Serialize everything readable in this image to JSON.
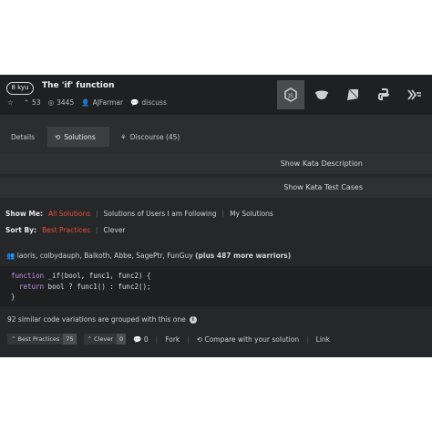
{
  "kata": {
    "rank": "8 kyu",
    "title": "The 'if' function",
    "votes": "53",
    "completed": "3445",
    "author": "AJFarmar",
    "discuss": "discuss"
  },
  "languages": [
    "javascript-icon",
    "coffeescript-icon",
    "ruby-icon",
    "python-icon",
    "haskell-icon",
    "more-icon"
  ],
  "tabs": {
    "details": "Details",
    "solutions": "Solutions",
    "discourse": "Discourse (45)"
  },
  "bars": {
    "description": "Show Kata Description",
    "test_cases": "Show Kata Test Cases"
  },
  "filters": {
    "show_me_label": "Show Me:",
    "show_me": [
      "All Solutions",
      "Solutions of Users I am Following",
      "My Solutions"
    ],
    "sort_by_label": "Sort By:",
    "sort_by": [
      "Best Practices",
      "Clever"
    ]
  },
  "solution": {
    "warriors": "laoris, colbydauph, Balkoth, Abbe, SagePtr, FunGuy",
    "more_warriors": "(plus 487 more warriors)",
    "code_line1_kw": "function",
    "code_line1_rest": " _if(bool, func1, func2) {",
    "code_line2_kw": "  return",
    "code_line2_rest": " bool ? func1() : func2();",
    "code_line3": "}",
    "grouped": "92 similar code variations are grouped with this one",
    "best_practices_label": "Best Practices",
    "best_practices_count": "75",
    "clever_label": "Clever",
    "clever_count": "0",
    "comments": "0",
    "fork": "Fork",
    "compare": "Compare with your solution",
    "link": "Link"
  },
  "colors": {
    "accent": "#e2503a",
    "background": "#262729"
  }
}
